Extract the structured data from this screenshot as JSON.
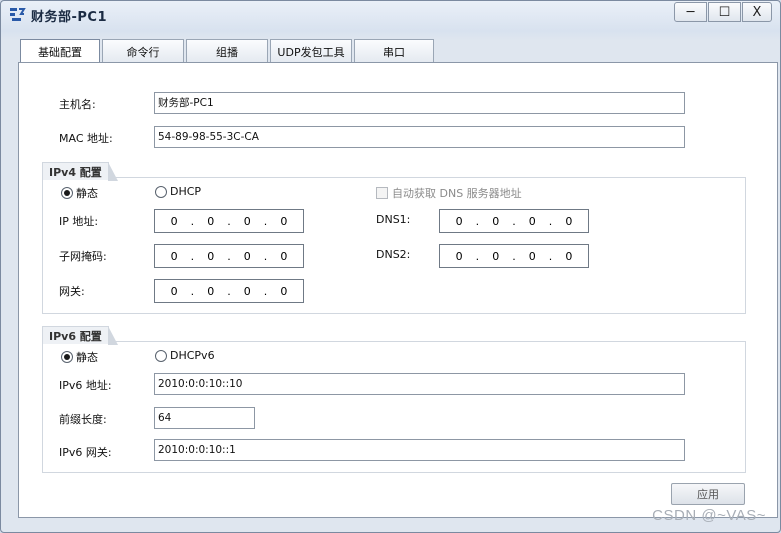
{
  "window": {
    "title": "财务部-PC1",
    "minimize": "─",
    "maximize": "☐",
    "close": "X"
  },
  "tabs": [
    "基础配置",
    "命令行",
    "组播",
    "UDP发包工具",
    "串口"
  ],
  "basic": {
    "hostname_label": "主机名:",
    "hostname_value": "财务部-PC1",
    "mac_label": "MAC 地址:",
    "mac_value": "54-89-98-55-3C-CA"
  },
  "ipv4": {
    "group_title": "IPv4 配置",
    "static_label": "静态",
    "dhcp_label": "DHCP",
    "auto_dns_label": "自动获取 DNS 服务器地址",
    "ip_label": "IP 地址:",
    "mask_label": "子网掩码:",
    "gateway_label": "网关:",
    "dns1_label": "DNS1:",
    "dns2_label": "DNS2:",
    "ip": [
      "0",
      "0",
      "0",
      "0"
    ],
    "mask": [
      "0",
      "0",
      "0",
      "0"
    ],
    "gateway": [
      "0",
      "0",
      "0",
      "0"
    ],
    "dns1": [
      "0",
      "0",
      "0",
      "0"
    ],
    "dns2": [
      "0",
      "0",
      "0",
      "0"
    ]
  },
  "ipv6": {
    "group_title": "IPv6 配置",
    "static_label": "静态",
    "dhcp_label": "DHCPv6",
    "addr_label": "IPv6 地址:",
    "addr_value": "2010:0:0:10::10",
    "prefix_label": "前缀长度:",
    "prefix_value": "64",
    "gateway_label": "IPv6 网关:",
    "gateway_value": "2010:0:0:10::1"
  },
  "apply_button": "应用",
  "watermark": "CSDN @~VAS~",
  "colors": {
    "title_text": "#1b2b43",
    "panel_bg": "#ffffff",
    "window_bg": "#dfe6ef"
  }
}
